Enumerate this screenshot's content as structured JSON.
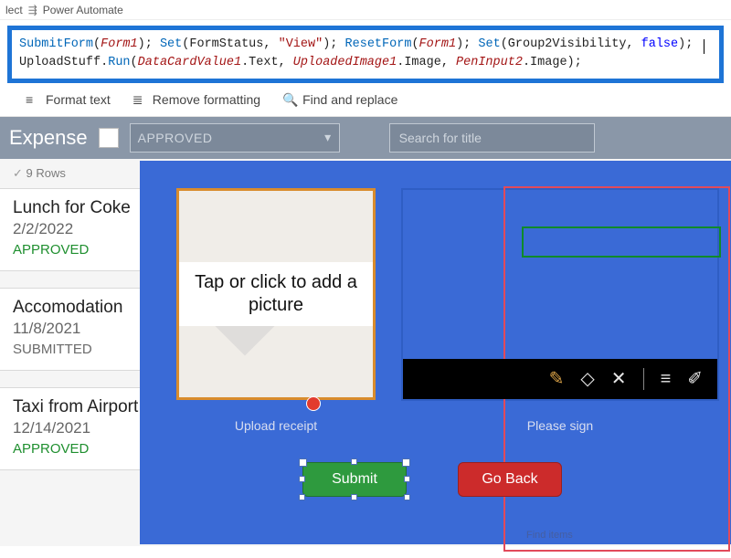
{
  "ribbon": {
    "select_hint": "lect",
    "power_automate": "Power Automate"
  },
  "formula": {
    "tokens": {
      "submitform": "SubmitForm",
      "form1a": "Form1",
      "set1": "Set",
      "formstatus": "FormStatus",
      "view": "\"View\"",
      "resetform": "ResetForm",
      "form1b": "Form1",
      "set2": "Set",
      "g2v": "Group2Visibility",
      "false": "false",
      "uploadstuff": "UploadStuff",
      "run": "Run",
      "dcv": "DataCardValue1",
      "text": ".Text, ",
      "upimg": "UploadedImage1",
      "image1": ".Image, ",
      "pen": "PenInput2",
      "image2": ".Image);"
    }
  },
  "fxbar": {
    "format": "Format text",
    "remove": "Remove formatting",
    "find": "Find and replace"
  },
  "header": {
    "title": "Expense",
    "approved_label": "APPROVED",
    "search_placeholder": "Search for title"
  },
  "rowcount": "9 Rows",
  "cards": [
    {
      "title": "Lunch for Coke",
      "date": "2/2/2022",
      "status": "APPROVED",
      "status_class": "st-approved"
    },
    {
      "title": "Accomodation",
      "date": "11/8/2021",
      "status": "SUBMITTED",
      "status_class": "st-submitted"
    },
    {
      "title": "Taxi from Airport",
      "date": "12/14/2021",
      "status": "APPROVED",
      "status_class": "st-approved"
    }
  ],
  "upload": {
    "tap_label": "Tap or click to add a picture",
    "caption": "Upload receipt"
  },
  "sign": {
    "caption": "Please sign"
  },
  "buttons": {
    "submit": "Submit",
    "goback": "Go Back"
  },
  "findtext": "Find items",
  "icons": {
    "pen": "pen-icon",
    "eraser": "eraser-icon",
    "close": "close-icon",
    "lines": "lines-icon",
    "edit": "edit-icon"
  }
}
